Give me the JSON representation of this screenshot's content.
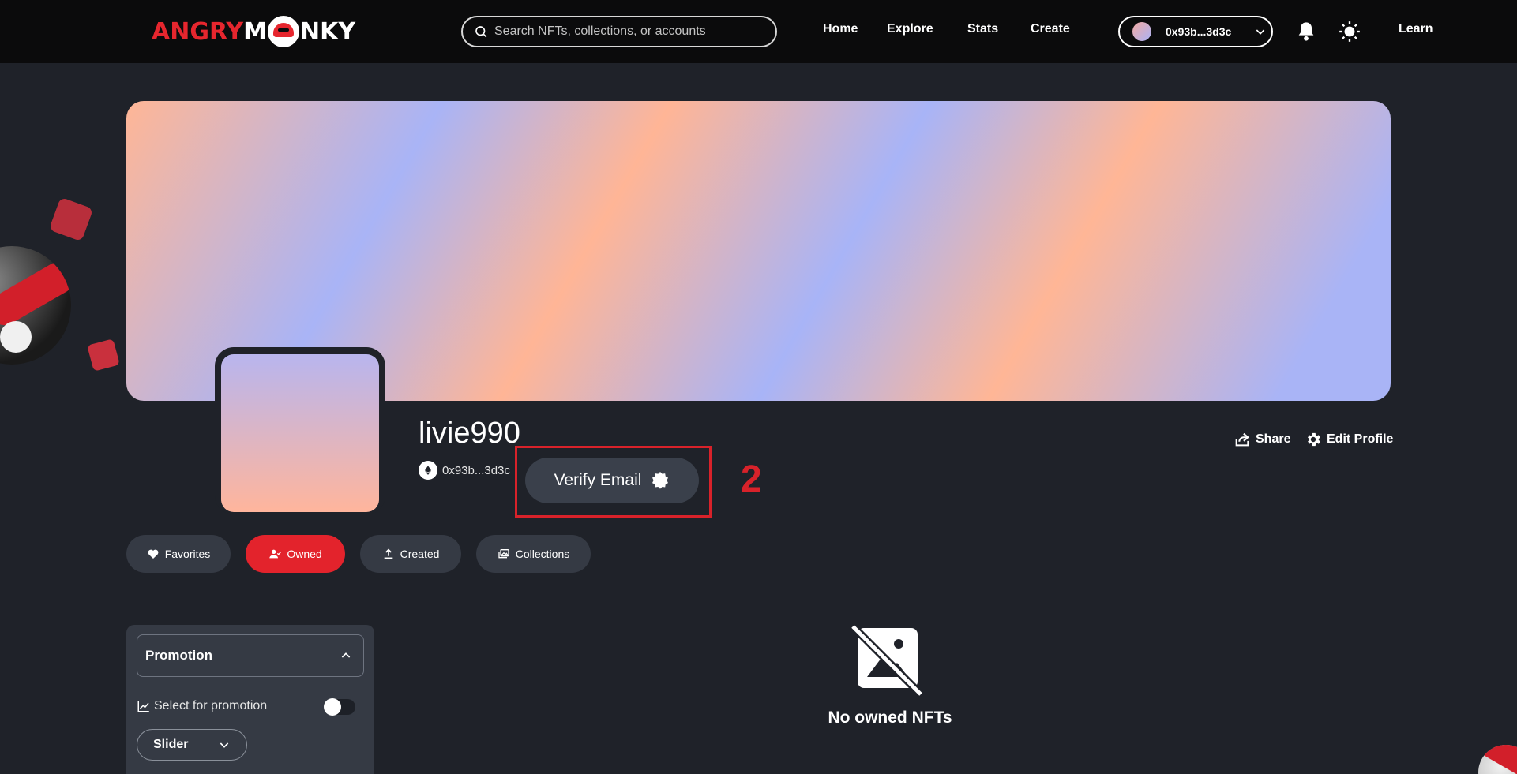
{
  "header": {
    "logo_left": "ANGRY",
    "logo_m": "M",
    "logo_right": "NKY",
    "search_placeholder": "Search NFTs, collections, or accounts",
    "nav": {
      "home": "Home",
      "explore": "Explore",
      "stats": "Stats",
      "create": "Create",
      "learn": "Learn"
    },
    "wallet": {
      "address": "0x93b...3d3c"
    }
  },
  "profile": {
    "username": "livie990",
    "address": "0x93b...3d3c",
    "verify_label": "Verify Email",
    "share_label": "Share",
    "edit_label": "Edit Profile",
    "annotation_number": "2"
  },
  "tabs": [
    {
      "label": "Favorites",
      "active": false
    },
    {
      "label": "Owned",
      "active": true
    },
    {
      "label": "Created",
      "active": false
    },
    {
      "label": "Collections",
      "active": false
    }
  ],
  "sidebar": {
    "promotion_title": "Promotion",
    "select_label": "Select for promotion",
    "toggle_on": false,
    "slider_value": "Slider"
  },
  "empty_state": {
    "text": "No owned NFTs"
  },
  "colors": {
    "accent": "#e3232c",
    "background": "#1f2229",
    "header": "#0b0b0c",
    "pill": "#353a44"
  },
  "icons": [
    "search-icon",
    "chevron-down-icon",
    "bell-icon",
    "sun-icon",
    "ethereum-icon",
    "verified-badge-icon",
    "share-icon",
    "gear-icon",
    "heart-icon",
    "user-icon",
    "upload-icon",
    "collections-icon",
    "chevron-up-icon",
    "chart-icon",
    "no-image-icon"
  ]
}
